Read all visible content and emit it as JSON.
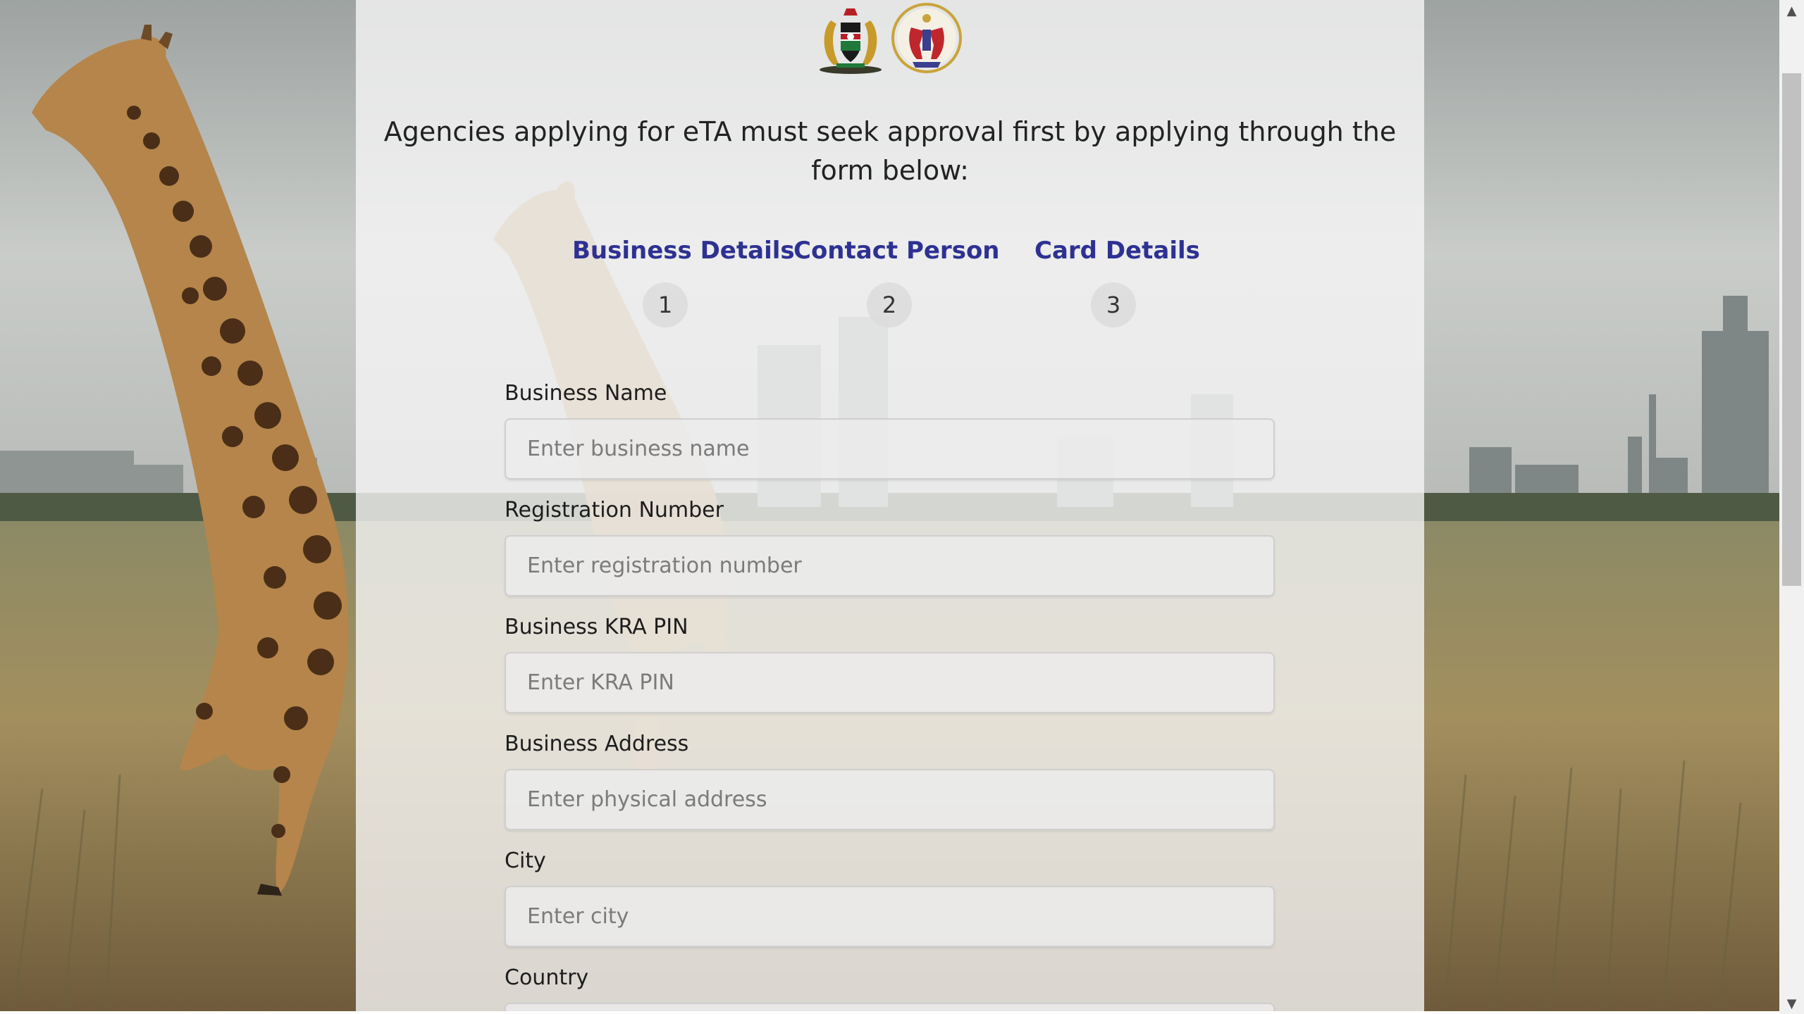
{
  "header": {
    "emblems": [
      "kenya-coat-of-arms-icon",
      "immigration-emblem-icon"
    ],
    "intro_text": "Agencies applying for eTA must seek approval first by applying through the form below:"
  },
  "stepper": {
    "steps": [
      {
        "label": "Business Details",
        "number": "1"
      },
      {
        "label": "Contact Person",
        "number": "2"
      },
      {
        "label": "Card Details",
        "number": "3"
      }
    ],
    "active_color": "#2e3192"
  },
  "form": {
    "fields": [
      {
        "label": "Business Name",
        "placeholder": "Enter business name"
      },
      {
        "label": "Registration Number",
        "placeholder": "Enter registration number"
      },
      {
        "label": "Business KRA PIN",
        "placeholder": "Enter KRA PIN"
      },
      {
        "label": "Business Address",
        "placeholder": "Enter physical address"
      },
      {
        "label": "City",
        "placeholder": "Enter city"
      },
      {
        "label": "Country",
        "placeholder": ""
      }
    ]
  },
  "scrollbar": {
    "up_icon": "scroll-up-arrow-icon",
    "down_icon": "scroll-down-arrow-icon"
  }
}
